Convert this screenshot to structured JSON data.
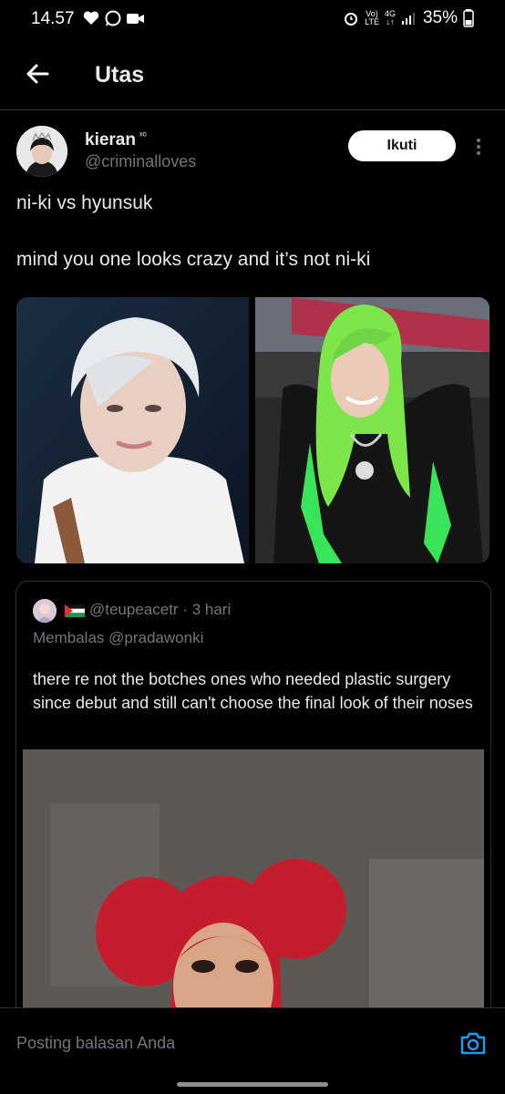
{
  "status_bar": {
    "time": "14.57",
    "network_top": "Vo)",
    "network_bottom": "LTE",
    "signal_type": "4G",
    "battery": "35%"
  },
  "header": {
    "title": "Utas"
  },
  "tweet": {
    "author_name": "kieran",
    "author_badge": "ˣᵒ",
    "author_handle": "@criminalloves",
    "follow_label": "Ikuti",
    "text_line1": "ni-ki vs hyunsuk",
    "text_line2": "mind you one looks crazy and it’s not ni-ki"
  },
  "quote": {
    "handle_time": "@teupeacetr · 3 hari",
    "reply_to": "Membalas @pradawonki",
    "text": "there re not the botches ones who needed plastic surgery since debut and still can't choose the final look of their noses"
  },
  "reply_bar": {
    "placeholder": "Posting balasan Anda"
  },
  "colors": {
    "accent": "#1d9bf0",
    "background": "#000000",
    "secondary_text": "#71767b"
  }
}
